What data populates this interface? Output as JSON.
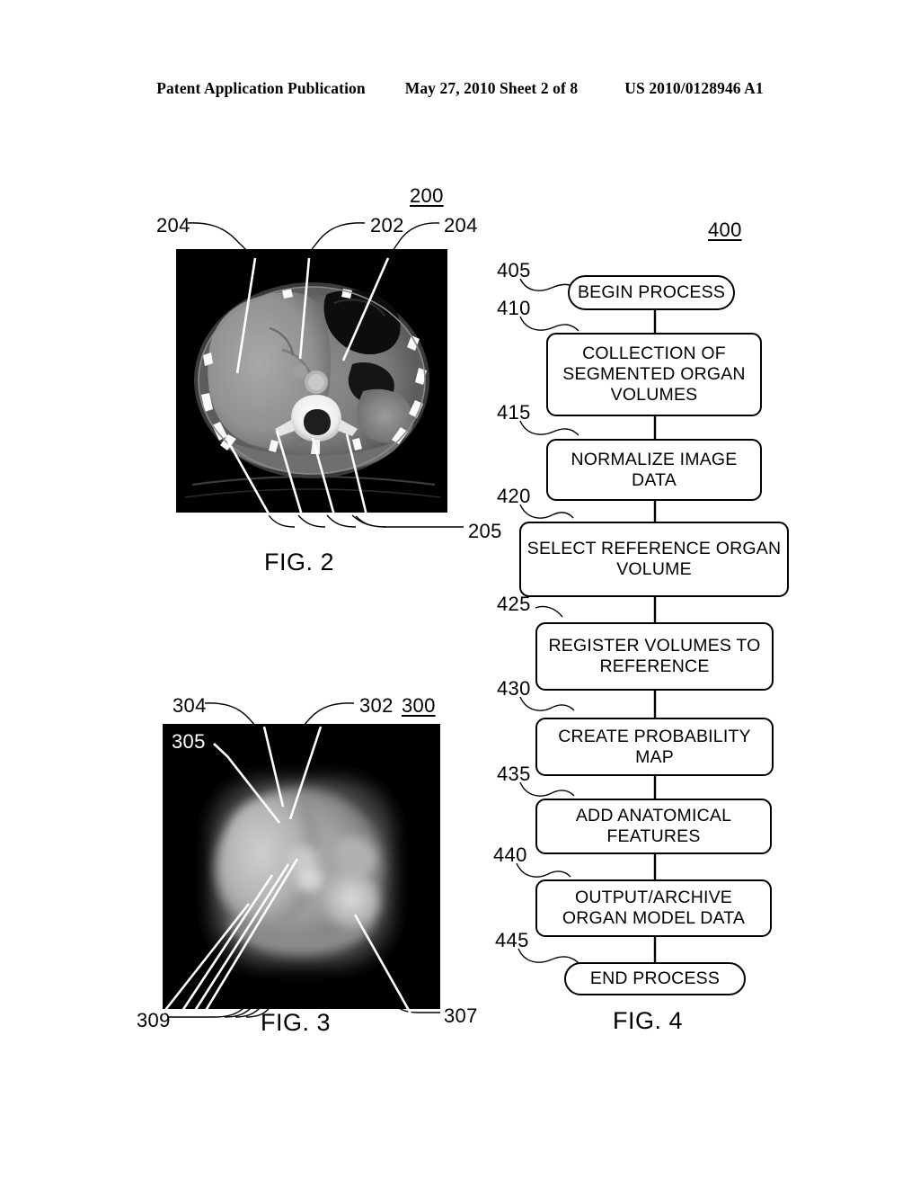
{
  "header": {
    "publication": "Patent Application Publication",
    "date_sheet": "May 27, 2010  Sheet 2 of 8",
    "patent_number": "US 2010/0128946 A1"
  },
  "figure2": {
    "caption": "FIG. 2",
    "figure_ref": "200",
    "description": "Axial CT slice of the upper abdomen showing liver, aorta, vertebra and ribs",
    "labels": {
      "top_left": "204",
      "top_center": "202",
      "top_right": "204",
      "bottom_right": "205"
    }
  },
  "figure3": {
    "caption": "FIG. 3",
    "figure_ref": "300",
    "description": "Blurred probabilistic organ model map derived from registered segmented volumes",
    "labels": {
      "top_left": "304",
      "top_center": "302",
      "inside_top_left": "305",
      "bottom_left": "309",
      "bottom_right": "307"
    }
  },
  "figure4": {
    "caption": "FIG. 4",
    "figure_ref": "400",
    "nodes": [
      {
        "ref": "405",
        "label": "BEGIN PROCESS",
        "shape": "terminal"
      },
      {
        "ref": "410",
        "label": "COLLECTION OF SEGMENTED ORGAN VOLUMES",
        "shape": "process"
      },
      {
        "ref": "415",
        "label": "NORMALIZE IMAGE DATA",
        "shape": "process"
      },
      {
        "ref": "420",
        "label": "SELECT REFERENCE ORGAN VOLUME",
        "shape": "process"
      },
      {
        "ref": "425",
        "label": "REGISTER VOLUMES TO REFERENCE",
        "shape": "process"
      },
      {
        "ref": "430",
        "label": "CREATE PROBABILITY MAP",
        "shape": "process"
      },
      {
        "ref": "435",
        "label": "ADD ANATOMICAL FEATURES",
        "shape": "process"
      },
      {
        "ref": "440",
        "label": "OUTPUT/ARCHIVE ORGAN  MODEL DATA",
        "shape": "process"
      },
      {
        "ref": "445",
        "label": "END PROCESS",
        "shape": "terminal"
      }
    ]
  }
}
